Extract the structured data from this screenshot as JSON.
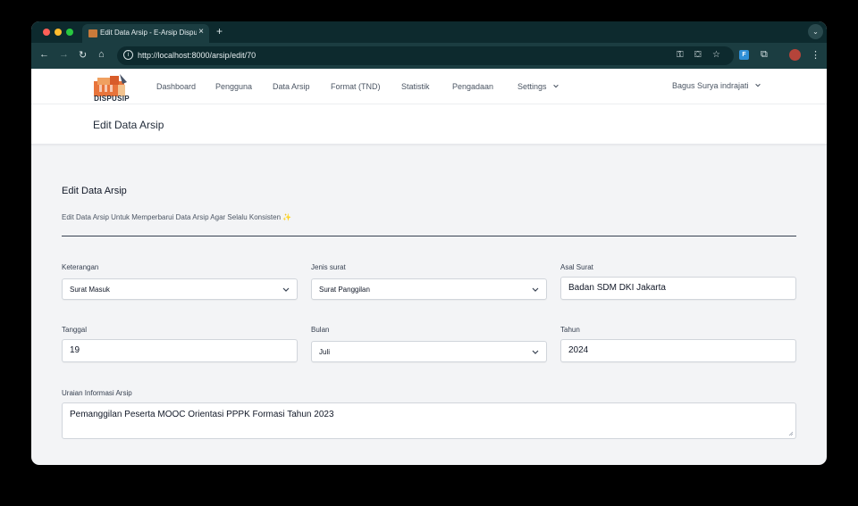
{
  "browser": {
    "tab_title": "Edit Data Arsip - E-Arsip Dispusip",
    "tab_close": "×",
    "new_tab": "+",
    "url": "http://localhost:8000/arsip/edit/70",
    "colors": {
      "frame": "#0d2a2e",
      "toolbar": "#1b3d41"
    }
  },
  "nav": {
    "logo_text": "DISPUSIP",
    "links": [
      "Dashboard",
      "Pengguna",
      "Data Arsip",
      "Format (TND)",
      "Statistik",
      "Pengadaan",
      "Settings"
    ],
    "user": "Bagus Surya indrajati"
  },
  "header": {
    "title": "Edit Data Arsip"
  },
  "form": {
    "title": "Edit Data Arsip",
    "description": "Edit Data Arsip Untuk Memperbarui Data Arsip Agar Selalu Konsisten ✨",
    "keterangan": {
      "label": "Keterangan",
      "value": "Surat Masuk"
    },
    "jenis_surat": {
      "label": "Jenis surat",
      "value": "Surat Panggilan"
    },
    "asal_surat": {
      "label": "Asal Surat",
      "value": "Badan SDM DKI Jakarta"
    },
    "tanggal": {
      "label": "Tanggal",
      "value": "19"
    },
    "bulan": {
      "label": "Bulan",
      "value": "Juli"
    },
    "tahun": {
      "label": "Tahun",
      "value": "2024"
    },
    "uraian": {
      "label": "Uraian Informasi Arsip",
      "value": "Pemanggilan Peserta MOOC Orientasi PPPK Formasi Tahun 2023"
    }
  }
}
